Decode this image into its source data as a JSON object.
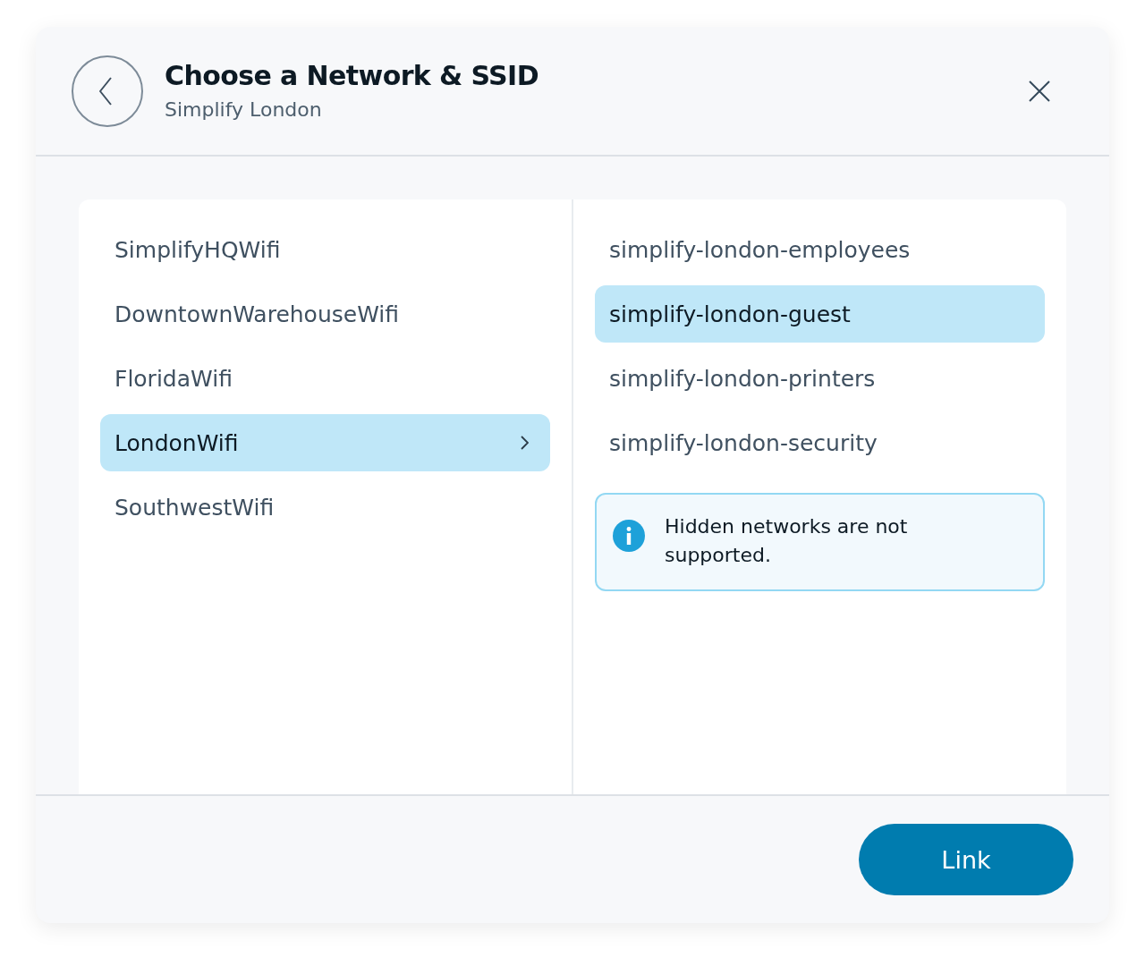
{
  "dialog": {
    "title": "Choose a Network & SSID",
    "subtitle": "Simplify London"
  },
  "networks": [
    {
      "label": "SimplifyHQWifi",
      "selected": false
    },
    {
      "label": "DowntownWarehouseWifi",
      "selected": false
    },
    {
      "label": "FloridaWifi",
      "selected": false
    },
    {
      "label": "LondonWifi",
      "selected": true
    },
    {
      "label": "SouthwestWifi",
      "selected": false
    }
  ],
  "ssids": [
    {
      "label": "simplify-london-employees",
      "selected": false
    },
    {
      "label": "simplify-london-guest",
      "selected": true
    },
    {
      "label": "simplify-london-printers",
      "selected": false
    },
    {
      "label": "simplify-london-security",
      "selected": false
    }
  ],
  "notice": {
    "kind": "info",
    "text": "Hidden networks are not supported."
  },
  "buttons": [
    {
      "label": "Link",
      "kind": "primary"
    }
  ]
}
